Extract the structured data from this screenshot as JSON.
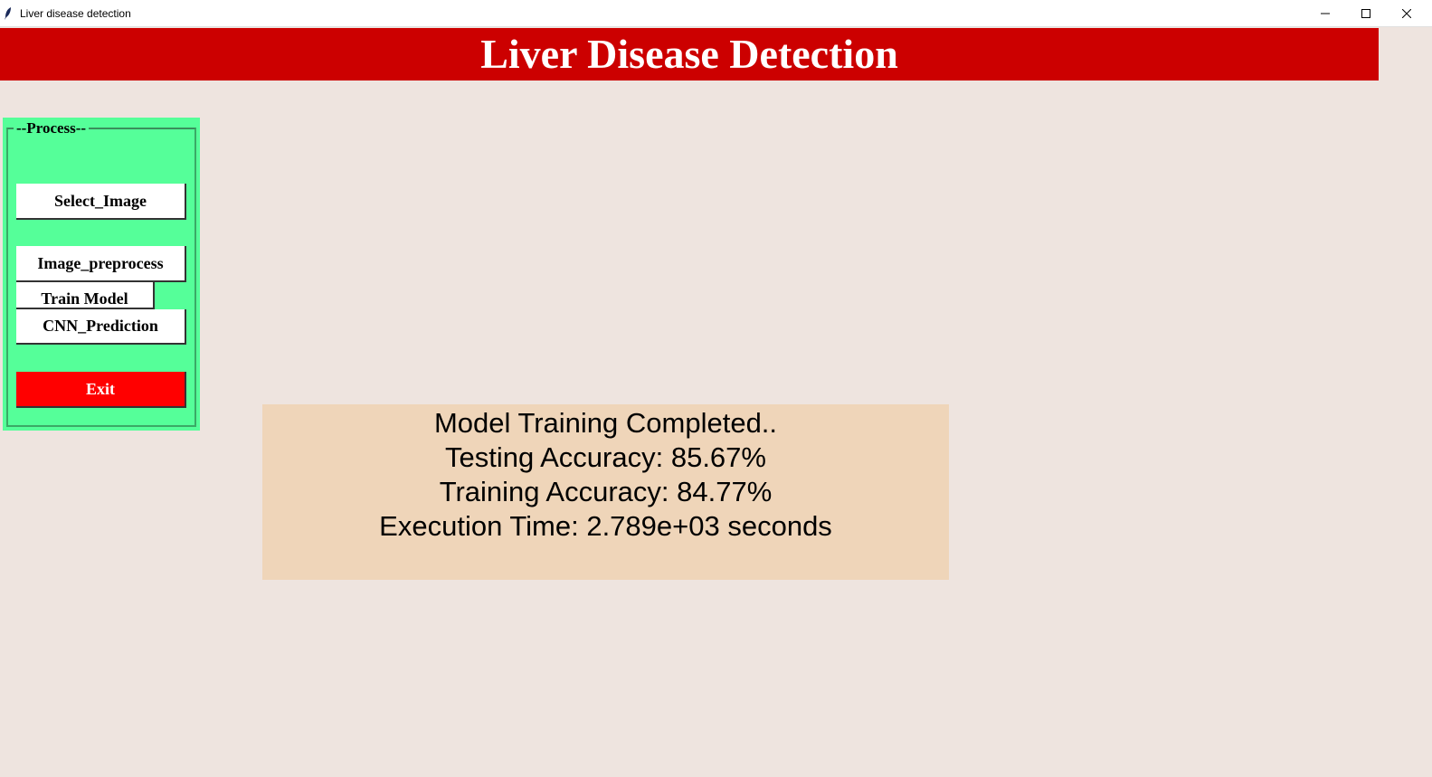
{
  "window": {
    "title": "Liver disease detection",
    "app_icon": "feather-icon",
    "controls": {
      "minimize_icon": "minimize-icon",
      "maximize_icon": "maximize-icon",
      "close_icon": "close-icon"
    }
  },
  "banner": {
    "title": "Liver Disease Detection",
    "background": "#cc0000",
    "color": "#ffffff"
  },
  "process": {
    "label": "--Process--",
    "background": "#55ff99",
    "buttons": {
      "select_image": "Select_Image",
      "image_preprocess": "Image_preprocess",
      "train_model": "Train Model",
      "cnn_prediction": "CNN_Prediction",
      "exit": "Exit"
    },
    "exit_color": "#ff0000"
  },
  "result": {
    "background": "#efd5b9",
    "lines": [
      "Model Training Completed..",
      "Testing Accuracy: 85.67%",
      "Training Accuracy: 84.77%",
      "Execution Time: 2.789e+03 seconds"
    ]
  }
}
